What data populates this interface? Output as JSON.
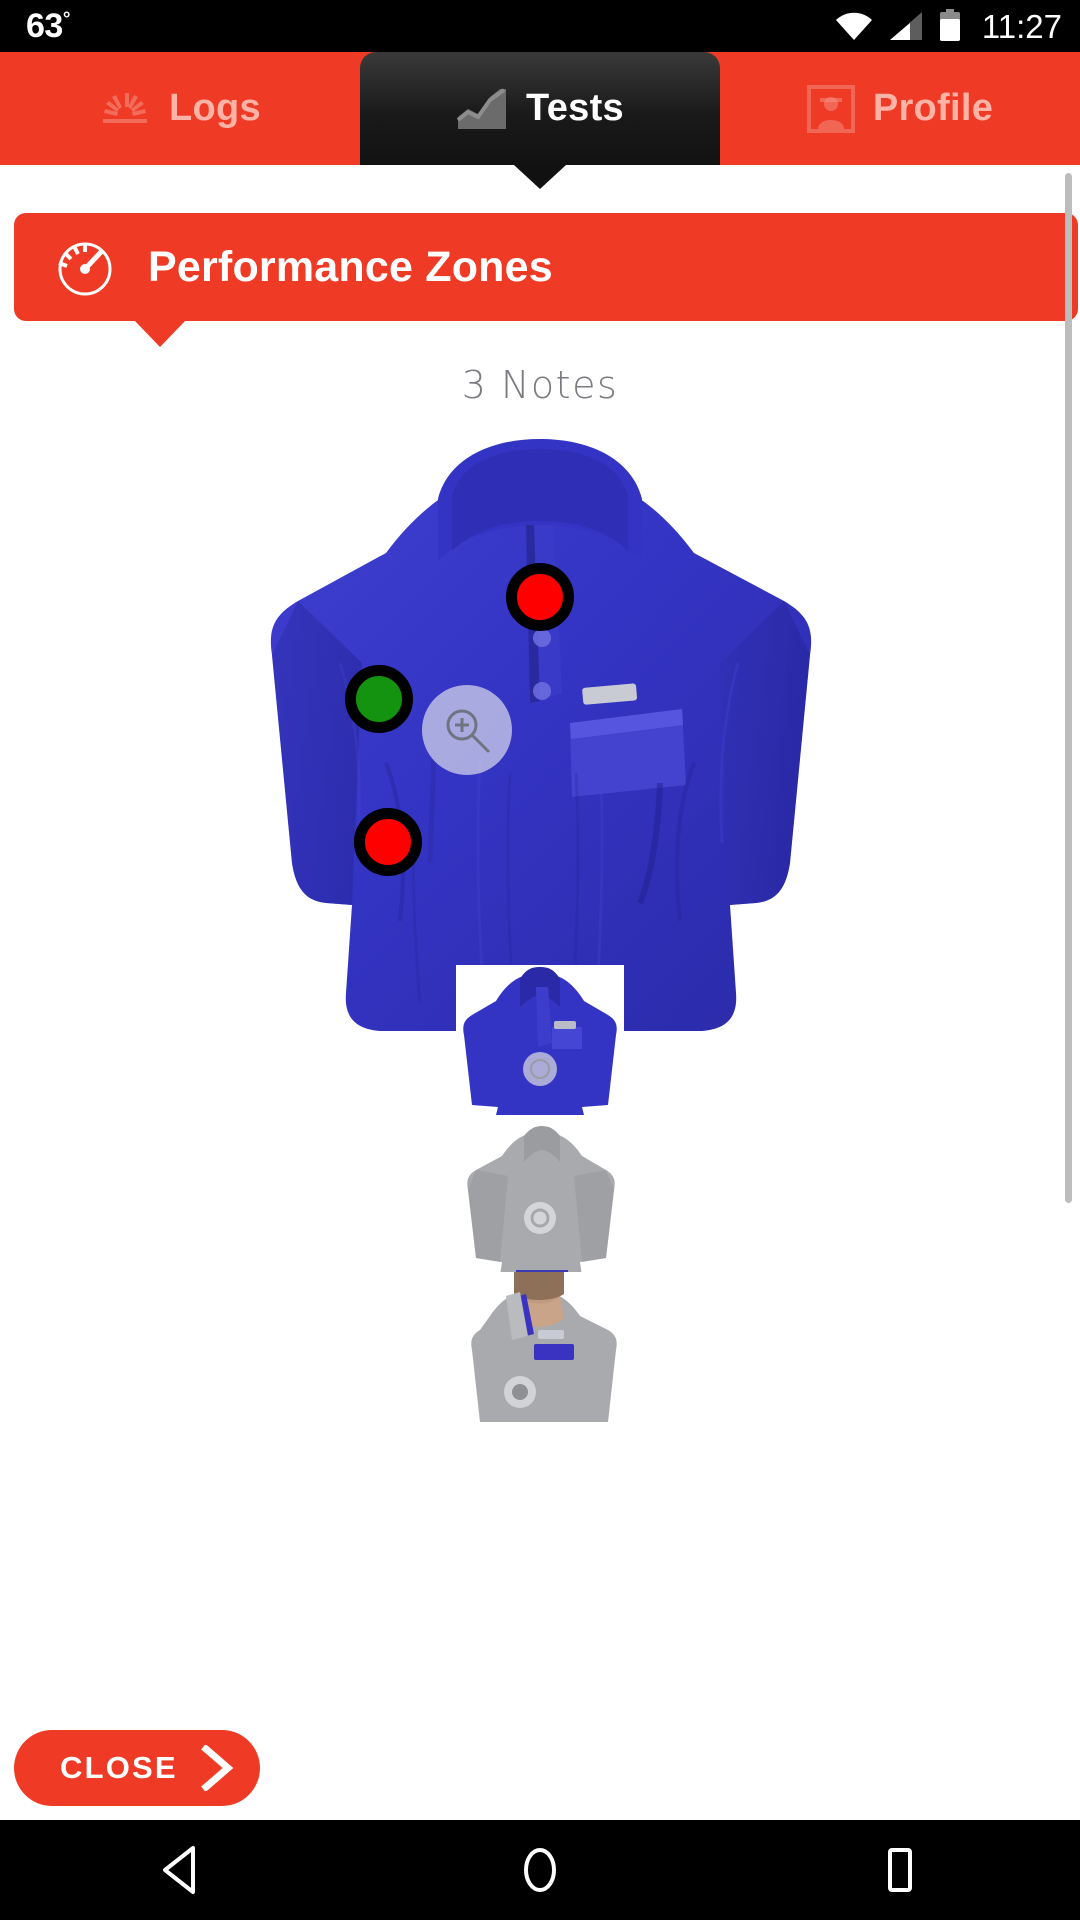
{
  "status_bar": {
    "temperature": "63",
    "degree_symbol": "°",
    "clock": "11:27",
    "icons": [
      "wifi-icon",
      "cellular-signal-icon",
      "battery-icon"
    ]
  },
  "tabs": [
    {
      "label": "Logs",
      "icon": "speedometer-icon",
      "active": false
    },
    {
      "label": "Tests",
      "icon": "line-chart-icon",
      "active": true
    },
    {
      "label": "Profile",
      "icon": "person-frame-icon",
      "active": false
    }
  ],
  "banner": {
    "title": "Performance Zones",
    "icon": "gauge-icon",
    "color": "#ef3a25"
  },
  "main": {
    "notes_count_label": "3 Notes",
    "hero": {
      "alt": "blue fleece pullover jacket",
      "zoom_icon": "magnifier-plus-icon",
      "markers": [
        {
          "name": "marker-red-chest",
          "color": "#fe0000",
          "status": "red"
        },
        {
          "name": "marker-green-torso",
          "color": "#13930f",
          "status": "green"
        },
        {
          "name": "marker-red-lower",
          "color": "#fe0000",
          "status": "red"
        }
      ]
    },
    "thumbnails": [
      {
        "alt": "blue fleece pullover front",
        "selected": true
      },
      {
        "alt": "gray fleece pullover back",
        "selected": false
      },
      {
        "alt": "model wearing gray fleece pullover",
        "selected": false
      }
    ]
  },
  "close_button": {
    "label": "CLOSE",
    "icon": "chevron-right-icon"
  },
  "nav_bar": {
    "back": "back-triangle-icon",
    "home": "home-circle-icon",
    "recents": "recents-square-icon"
  },
  "colors": {
    "brand_red": "#ef3a25",
    "tab_inactive_text": "#ffb3a6",
    "notes_text": "#7a7a80",
    "marker_red": "#fe0000",
    "marker_green": "#13930f"
  }
}
